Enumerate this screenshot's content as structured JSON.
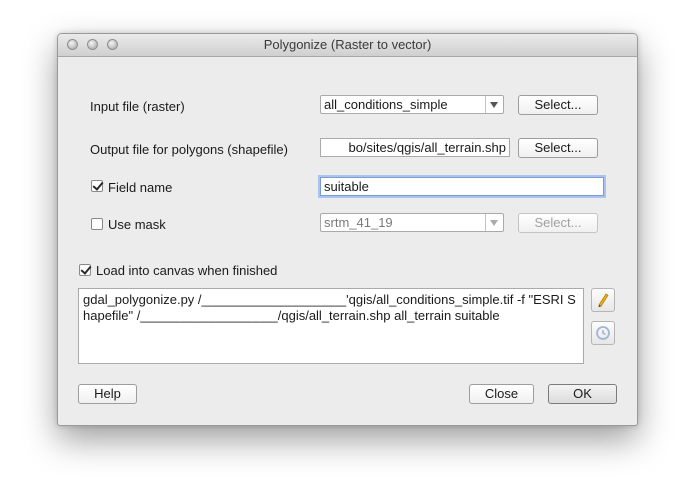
{
  "window": {
    "title": "Polygonize (Raster to vector)"
  },
  "form": {
    "input_label": "Input file (raster)",
    "input_value": "all_conditions_simple",
    "input_select": "Select...",
    "output_label": "Output file for polygons (shapefile)",
    "output_value": "bo/sites/qgis/all_terrain.shp",
    "output_select": "Select...",
    "field_label": "Field name",
    "field_checked": true,
    "field_value": "suitable",
    "mask_label": "Use mask",
    "mask_checked": false,
    "mask_value": "srtm_41_19",
    "mask_select": "Select..."
  },
  "load": {
    "label": "Load into canvas when finished",
    "checked": true
  },
  "command": {
    "text": "gdal_polygonize.py /____________________'qgis/all_conditions_simple.tif -f \"ESRI Shapefile\" /___________________/qgis/all_terrain.shp all_terrain suitable"
  },
  "icons": {
    "edit": "pencil-icon",
    "reset": "reset-icon"
  },
  "buttons": {
    "help": "Help",
    "close": "Close",
    "ok": "OK"
  }
}
